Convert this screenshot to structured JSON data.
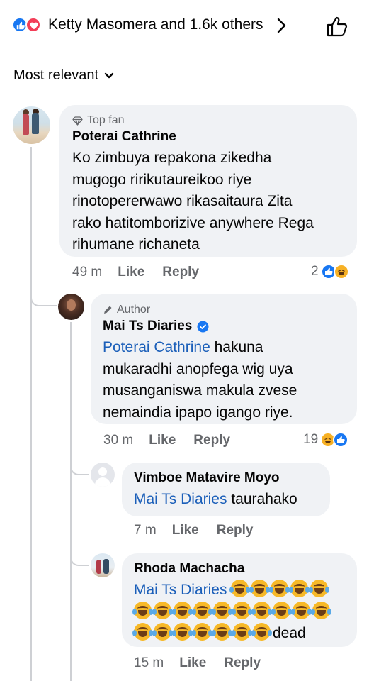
{
  "header": {
    "reactors_text": "Ketty Masomera and 1.6k others",
    "icons": [
      "like-icon",
      "love-icon",
      "chevron-right-icon",
      "thumbs-up-outline-icon"
    ]
  },
  "sort": {
    "label": "Most relevant"
  },
  "colors": {
    "like": "#1877f2",
    "love": "#f33e58",
    "mention": "#1b5fb9",
    "bubble": "#f0f2f5",
    "meta": "#65676b"
  },
  "comments": [
    {
      "badge": "Top fan",
      "badge_icon": "diamond-icon",
      "author": "Poterai Cathrine",
      "lines": [
        "Ko zimbuya repakona zikedha",
        "mugogo ririkutaureikoo riye",
        "rinotopererwawo rikasaitaura Zita",
        "rako hatitomborizive anywhere Rega",
        "rihumane richaneta"
      ],
      "time": "49 m",
      "like_label": "Like",
      "reply_label": "Reply",
      "reaction_count": "2",
      "reactions": [
        "like-icon",
        "haha-icon"
      ]
    },
    {
      "badge": "Author",
      "badge_icon": "pen-icon",
      "author": "Mai Ts Diaries",
      "verified": true,
      "mention": "Poterai Cathrine",
      "lines": [
        "hakuna",
        "mukaradhi anopfega wig uya",
        "musanganiswa makula zvese",
        "nemaindia ipapo igango riye."
      ],
      "time": "30 m",
      "like_label": "Like",
      "reply_label": "Reply",
      "reaction_count": "19",
      "reactions": [
        "haha-icon",
        "like-icon"
      ]
    },
    {
      "author": "Vimboe Matavire Moyo",
      "mention": "Mai Ts Diaries",
      "text": "taurahako",
      "time": "7 m",
      "like_label": "Like",
      "reply_label": "Reply"
    },
    {
      "author": "Rhoda Machacha",
      "mention": "Mai Ts Diaries",
      "emoji_name": "rolling-laughing-emoji",
      "trailing_text": "dead",
      "time": "15 m",
      "like_label": "Like",
      "reply_label": "Reply"
    }
  ]
}
